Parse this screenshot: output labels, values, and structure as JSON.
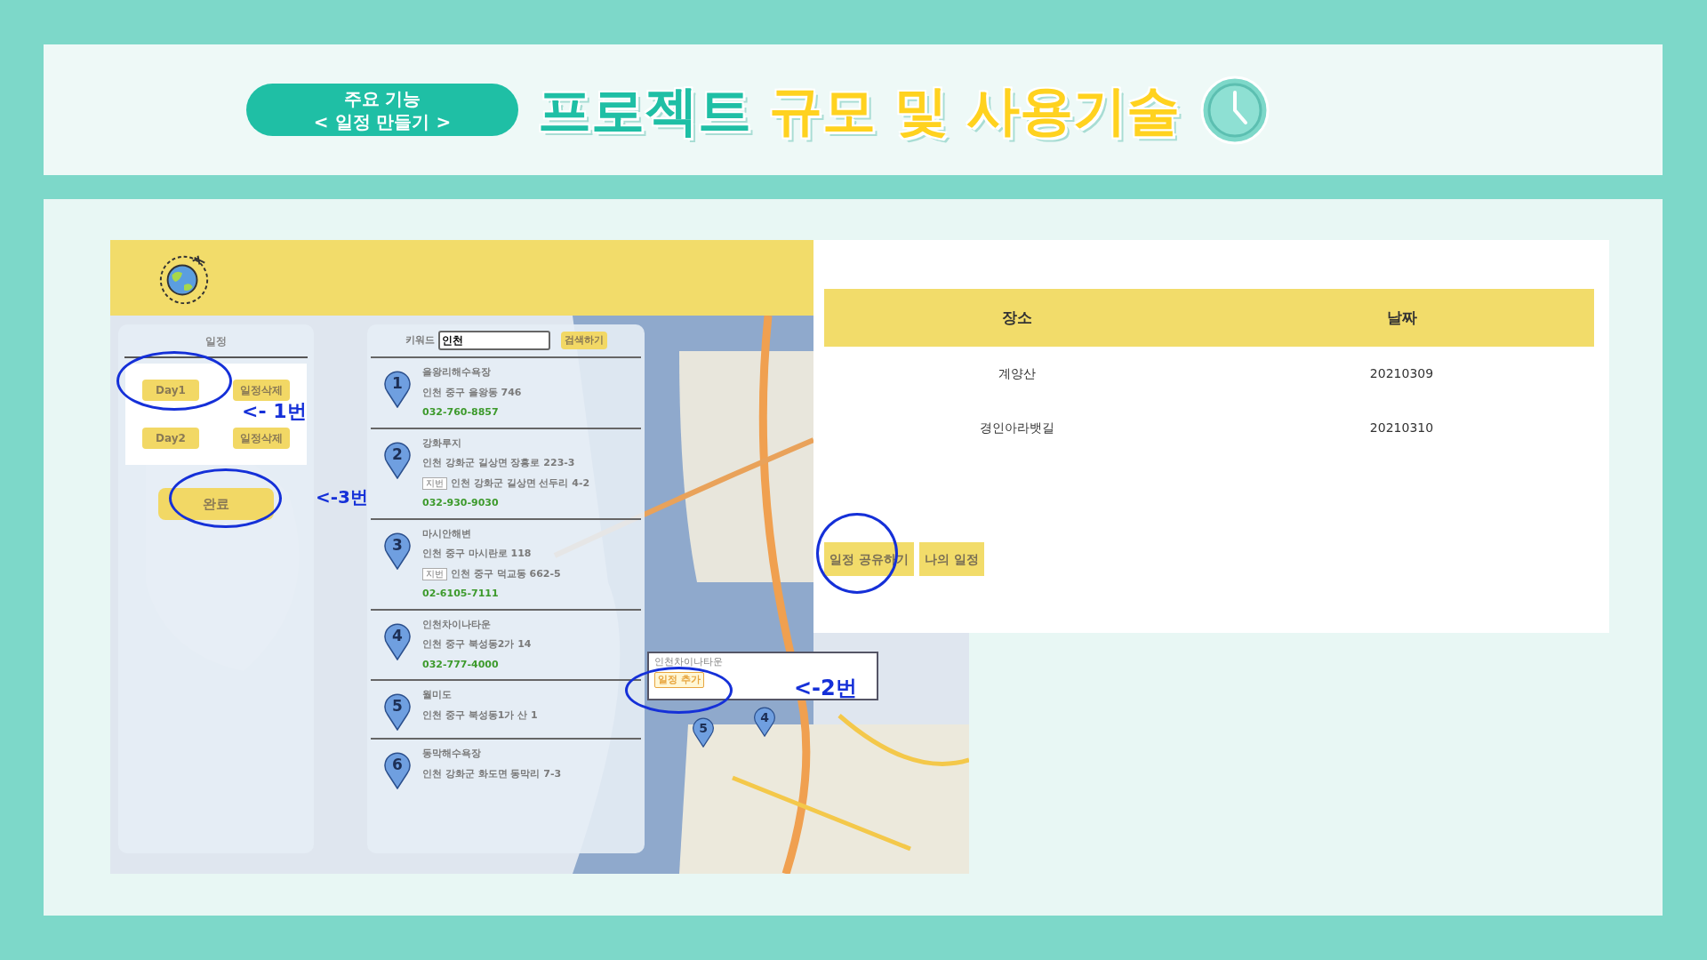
{
  "slide": {
    "badge_lines": [
      "주요 기능",
      "< 일정 만들기 >"
    ],
    "title_parts": [
      {
        "text": "프로젝트",
        "color": "#1fbfa5"
      },
      {
        "text": "규모 및 사용기술",
        "color": "#ffd21f"
      }
    ]
  },
  "schedule_panel": {
    "title": "일정",
    "days": [
      {
        "label": "Day1",
        "delete": "일정삭제"
      },
      {
        "label": "Day2",
        "delete": "일정삭제"
      }
    ],
    "done": "완료"
  },
  "search": {
    "label": "키워드",
    "value": "인천",
    "button": "검색하기"
  },
  "results": [
    {
      "number": "1",
      "name": "을왕리해수욕장",
      "address": "인천 중구 을왕동 746",
      "phone": "032-760-8857"
    },
    {
      "number": "2",
      "name": "강화루지",
      "address": "인천 강화군 길상면 장흥로 223-3",
      "lot_tag": "지번",
      "lot_address": "인천 강화군 길상면 선두리 4-2",
      "phone": "032-930-9030"
    },
    {
      "number": "3",
      "name": "마시안해변",
      "address": "인천 중구 마시란로 118",
      "lot_tag": "지번",
      "lot_address": "인천 중구 덕교동 662-5",
      "phone": "02-6105-7111"
    },
    {
      "number": "4",
      "name": "인천차이나타운",
      "address": "인천 중구 북성동2가 14",
      "phone": "032-777-4000"
    },
    {
      "number": "5",
      "name": "월미도",
      "address": "인천 중구 북성동1가 산 1"
    },
    {
      "number": "6",
      "name": "동막해수욕장",
      "address": "인천 강화군 화도면 동막리 7-3"
    }
  ],
  "popup": {
    "title": "인천차이나타운",
    "button": "일정 추가"
  },
  "map_markers": [
    "5",
    "4"
  ],
  "annotations": [
    "<- 1번",
    "<-3번",
    "<-2번"
  ],
  "table": {
    "columns": [
      "장소",
      "날짜"
    ],
    "rows": [
      [
        "계양산",
        "20210309"
      ],
      [
        "경인아라뱃길",
        "20210310"
      ]
    ]
  },
  "actions": [
    "일정 공유하기",
    "나의 일정"
  ]
}
